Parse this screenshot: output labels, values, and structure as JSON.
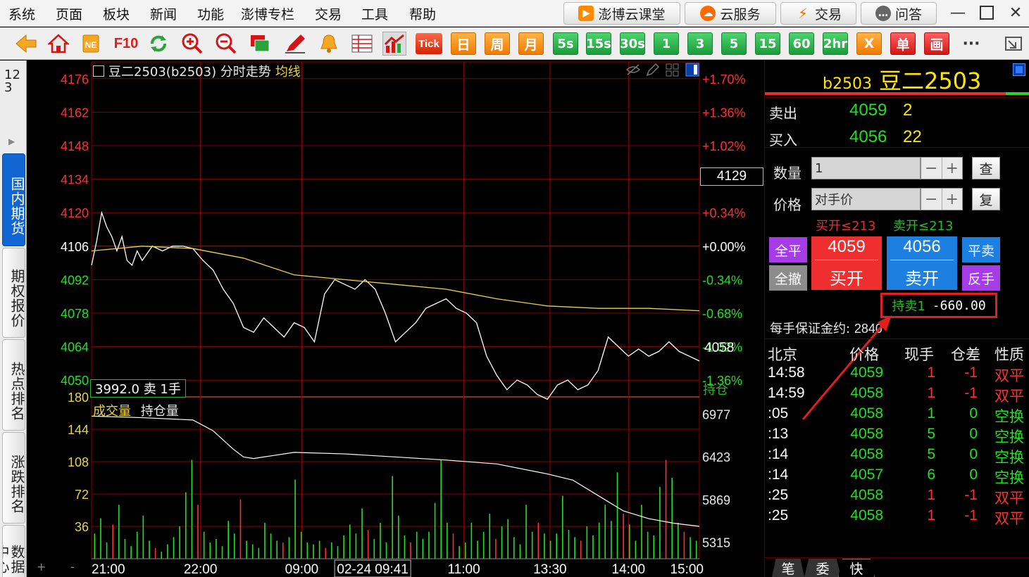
{
  "menubar": {
    "items": [
      "系统",
      "页面",
      "板块",
      "新闻",
      "功能",
      "澎博专栏",
      "交易",
      "工具",
      "帮助"
    ],
    "pills": [
      {
        "label": "澎博云课堂",
        "icon": "classroom-icon"
      },
      {
        "label": "云服务",
        "icon": "cloud-icon"
      },
      {
        "label": "交易",
        "icon": "lightning-icon"
      },
      {
        "label": "问答",
        "icon": "chat-icon"
      }
    ]
  },
  "toolbar": {
    "f10": "F10",
    "tick": "Tick",
    "periods": [
      "日",
      "周",
      "月",
      "5s",
      "15s",
      "30s",
      "1",
      "3",
      "5",
      "15",
      "60",
      "2hr"
    ],
    "extra": [
      "X",
      "单",
      "画"
    ],
    "more": "···"
  },
  "lefttabs": {
    "top": "123",
    "tabs": [
      "国内期货",
      "期权报价",
      "热点排名",
      "涨跌排名",
      "数据中心"
    ]
  },
  "chart": {
    "title": "豆二2503(b2503) 分时走势",
    "avg_label": "均线",
    "current_price": "4129",
    "last_price_tag": "4058",
    "info_box": "3992.0  卖  1手",
    "lower_labels": {
      "volume": "成交量",
      "oi": "持仓量"
    },
    "oi_axis_label": "持仓",
    "price_ticks": [
      "4176",
      "4162",
      "4148",
      "4134",
      "4120",
      "4106",
      "4092",
      "4078",
      "4064",
      "4050"
    ],
    "pct_ticks": [
      "+1.70%",
      "+1.36%",
      "+1.02%",
      "",
      "+0.34%",
      "+0.00%",
      "-0.34%",
      "-0.68%",
      "-1.02%",
      "-1.36%"
    ],
    "vol_ticks": [
      "180",
      "144",
      "108",
      "72",
      "36"
    ],
    "oi_ticks": [
      "6977",
      "6423",
      "5869",
      "5315"
    ],
    "time_ticks": [
      "21:00",
      "22:00",
      "09:00",
      "02-24 09:41",
      "11:00",
      "13:30",
      "14:00",
      "15:00"
    ],
    "bottom_controls": [
      "+",
      "-"
    ]
  },
  "chart_data": {
    "type": "line",
    "title": "豆二2503(b2503) 分时走势",
    "xlabel": "",
    "ylabel": "",
    "ylim": [
      4043,
      4183
    ],
    "prev_close": 4106,
    "x_ticks": [
      "21:00",
      "22:00",
      "09:00",
      "11:00",
      "13:30",
      "14:00",
      "15:00"
    ],
    "series": [
      {
        "name": "分时",
        "x": [
          0,
          1,
          2,
          3,
          4,
          5,
          6,
          7,
          8,
          9,
          10,
          12,
          14,
          16,
          18,
          20,
          22,
          24,
          26,
          28,
          30,
          32,
          34,
          36,
          38,
          40,
          42,
          44,
          46,
          48,
          50,
          52,
          54,
          56,
          58,
          60,
          62,
          64,
          66,
          68,
          70,
          72,
          74,
          76,
          78,
          80,
          82,
          84,
          86,
          88,
          90,
          92,
          94,
          96,
          98,
          100,
          102,
          104,
          106,
          108,
          110,
          112,
          114,
          116,
          118,
          120
        ],
        "values": [
          4098,
          4108,
          4120,
          4114,
          4110,
          4104,
          4110,
          4100,
          4098,
          4104,
          4100,
          4106,
          4104,
          4106,
          4106,
          4105,
          4100,
          4096,
          4088,
          4082,
          4072,
          4070,
          4076,
          4072,
          4068,
          4074,
          4072,
          4066,
          4086,
          4092,
          4090,
          4088,
          4092,
          4088,
          4078,
          4066,
          4070,
          4074,
          4080,
          4082,
          4084,
          4080,
          4078,
          4074,
          4060,
          4052,
          4046,
          4050,
          4048,
          4044,
          4042,
          4048,
          4050,
          4046,
          4048,
          4054,
          4068,
          4064,
          4060,
          4063,
          4060,
          4062,
          4066,
          4062,
          4060,
          4058
        ]
      },
      {
        "name": "均线",
        "x": [
          0,
          10,
          20,
          30,
          40,
          50,
          60,
          70,
          80,
          90,
          100,
          110,
          120
        ],
        "values": [
          4104,
          4106,
          4105,
          4101,
          4094,
          4092,
          4090,
          4088,
          4084,
          4081,
          4080,
          4080,
          4079
        ]
      }
    ],
    "volume": {
      "ylim": [
        0,
        180
      ],
      "sample_values": [
        28,
        45,
        18,
        38,
        60,
        22,
        14,
        30,
        48,
        20,
        12,
        8,
        16,
        24,
        36,
        74,
        110,
        60,
        30,
        18,
        22,
        14,
        42,
        28,
        66,
        20,
        16,
        12,
        40,
        28,
        20,
        18,
        24,
        88,
        30,
        18,
        16,
        20,
        12,
        18,
        14,
        26,
        38,
        28,
        56,
        32,
        22,
        40,
        18,
        92,
        48,
        26,
        18,
        30,
        22,
        30,
        62,
        110,
        40,
        28,
        14,
        18,
        40,
        20,
        30,
        50,
        22,
        36,
        44,
        24,
        16,
        60,
        30,
        40,
        28,
        20,
        28,
        70,
        32,
        24,
        20,
        36,
        26,
        40,
        60,
        42,
        96,
        50,
        38,
        20,
        60,
        30,
        26,
        80,
        110,
        90,
        40,
        30,
        24,
        20
      ]
    },
    "open_interest": {
      "ylim": [
        5100,
        7200
      ],
      "x": [
        0,
        10,
        20,
        24,
        28,
        30,
        32,
        40,
        50,
        60,
        70,
        80,
        90,
        95,
        100,
        105,
        110,
        115,
        120
      ],
      "values": [
        6950,
        6930,
        6900,
        6760,
        6520,
        6420,
        6400,
        6480,
        6460,
        6420,
        6380,
        6330,
        6200,
        6120,
        5920,
        5720,
        5620,
        5560,
        5520
      ]
    }
  },
  "rpanel": {
    "code": "b2503",
    "name": "豆二2503",
    "sell_label": "卖出",
    "sell_price": "4059",
    "sell_qty": "2",
    "buy_label": "买入",
    "buy_price": "4056",
    "buy_qty": "22",
    "qty_label": "数量",
    "qty_value": "1",
    "query_btn": "查",
    "price_label": "价格",
    "price_value": "对手价",
    "reset_btn": "复",
    "buy_open_limit": "买开≤213",
    "sell_open_limit": "卖开≤213",
    "close_all": "全平",
    "cancel_all": "全撤",
    "buy_open_price": "4059",
    "buy_open": "买开",
    "sell_open_price": "4056",
    "sell_open": "卖开",
    "close_sell": "平卖",
    "reverse": "反手",
    "position_label": "持卖1",
    "position_value": "-660.00",
    "margin_label": "每手保证金约:",
    "margin_value": "2840",
    "ticks_header": [
      "北京",
      "价格",
      "现手",
      "仓差",
      "性质"
    ],
    "ticks": [
      {
        "time": "14:58",
        "price": "4059",
        "vol": "1",
        "oi": "-1",
        "type": "双平",
        "color": "#ff3030"
      },
      {
        "time": "14:59",
        "price": "4058",
        "vol": "1",
        "oi": "-1",
        "type": "双平",
        "color": "#ff3030"
      },
      {
        "time": ":05",
        "price": "4058",
        "vol": "1",
        "oi": "0",
        "type": "空换",
        "color": "#1fe21f"
      },
      {
        "time": ":13",
        "price": "4058",
        "vol": "5",
        "oi": "0",
        "type": "空换",
        "color": "#1fe21f"
      },
      {
        "time": ":14",
        "price": "4058",
        "vol": "5",
        "oi": "0",
        "type": "空换",
        "color": "#1fe21f"
      },
      {
        "time": ":14",
        "price": "4057",
        "vol": "6",
        "oi": "0",
        "type": "空换",
        "color": "#1fe21f"
      },
      {
        "time": ":25",
        "price": "4058",
        "vol": "1",
        "oi": "-1",
        "type": "双平",
        "color": "#ff3030"
      },
      {
        "time": ":25",
        "price": "4058",
        "vol": "1",
        "oi": "-1",
        "type": "双平",
        "color": "#ff3030"
      }
    ],
    "bottom_tabs": [
      "笔",
      "委",
      "快"
    ]
  },
  "colors": {
    "up": "#ff3030",
    "down": "#1fe21f",
    "grid": "#8b0000",
    "bg": "#000000",
    "accent": "#1266d4",
    "avg_line": "#e8d24a",
    "annotation": "#e02020"
  }
}
